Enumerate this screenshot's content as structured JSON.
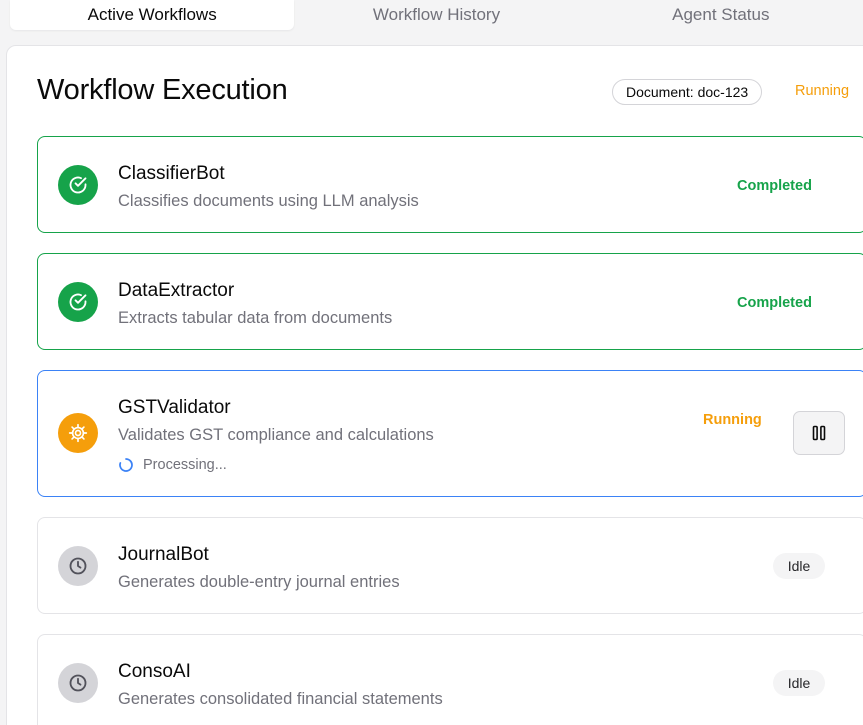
{
  "tabs": [
    {
      "label": "Active Workflows",
      "active": true
    },
    {
      "label": "Workflow History",
      "active": false
    },
    {
      "label": "Agent Status",
      "active": false
    }
  ],
  "header": {
    "title": "Workflow Execution",
    "document_badge": "Document: doc-123",
    "status": "Running"
  },
  "agents": [
    {
      "name": "ClassifierBot",
      "description": "Classifies documents using LLM analysis",
      "status": "Completed",
      "icon": "check-circle-icon"
    },
    {
      "name": "DataExtractor",
      "description": "Extracts tabular data from documents",
      "status": "Completed",
      "icon": "check-circle-icon"
    },
    {
      "name": "GSTValidator",
      "description": "Validates GST compliance and calculations",
      "status": "Running",
      "icon": "gear-icon",
      "progress_text": "Processing..."
    },
    {
      "name": "JournalBot",
      "description": "Generates double-entry journal entries",
      "status": "Idle",
      "icon": "clock-icon"
    },
    {
      "name": "ConsoAI",
      "description": "Generates consolidated financial statements",
      "status": "Idle",
      "icon": "clock-icon"
    }
  ],
  "colors": {
    "completed": "#16a34a",
    "running": "#f59e0b",
    "running_border": "#3b82f6",
    "idle_icon": "#d4d4d8"
  }
}
